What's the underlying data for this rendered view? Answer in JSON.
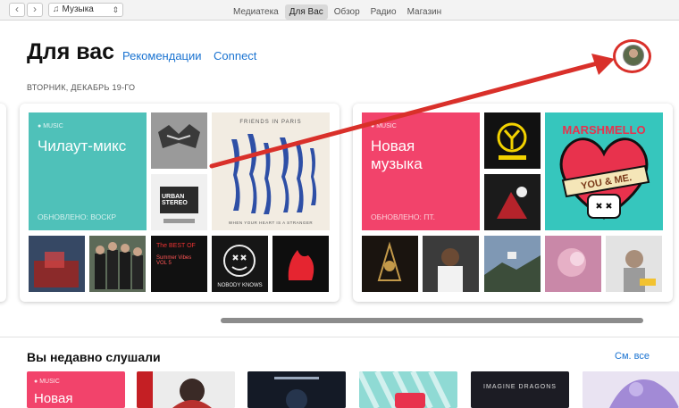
{
  "toolbar": {
    "back_icon": "chevron-left-icon",
    "forward_icon": "chevron-right-icon",
    "library_select": {
      "icon": "music-note-icon",
      "value": "Музыка"
    },
    "tabs": [
      {
        "label": "Медиатека",
        "active": false
      },
      {
        "label": "Для Вас",
        "active": true
      },
      {
        "label": "Обзор",
        "active": false
      },
      {
        "label": "Радио",
        "active": false
      },
      {
        "label": "Магазин",
        "active": false
      }
    ]
  },
  "header": {
    "title": "Для вас",
    "links": [
      "Рекомендации",
      "Connect"
    ],
    "date": "ВТОРНИК, ДЕКАБРЬ 19-ГО",
    "avatar_icon": "user-avatar-icon"
  },
  "mixes": [
    {
      "brand": "MUSIC",
      "title": "Чилаут-микс",
      "updated": "ОБНОВЛЕНО: ВОСКР",
      "color": "#4fc1b9"
    },
    {
      "brand": "MUSIC",
      "title_lines": [
        "Новая",
        "музыка"
      ],
      "updated": "ОБНОВЛЕНО: ПТ.",
      "color": "#f2436b"
    }
  ],
  "album_text": {
    "friends": "FRIENDS IN PARIS",
    "friends_sub": "WHEN YOUR HEART IS A STRANGER",
    "marsh": "MARSHMELLO",
    "you_me": "YOU & ME.",
    "nobody": "NOBODY KNOWS",
    "urban": "URBAN STEREO",
    "best_of": "The BEST OF",
    "best_of_sub": "Summer Vibes VOL 5"
  },
  "recent": {
    "title": "Вы недавно слушали",
    "see_all": "См. все",
    "first_brand": "MUSIC",
    "first_title": "Новая",
    "imagine": "IMAGINE DRAGONS"
  },
  "colors": {
    "accent": "#1a73d1",
    "annotation": "#d9302a"
  }
}
